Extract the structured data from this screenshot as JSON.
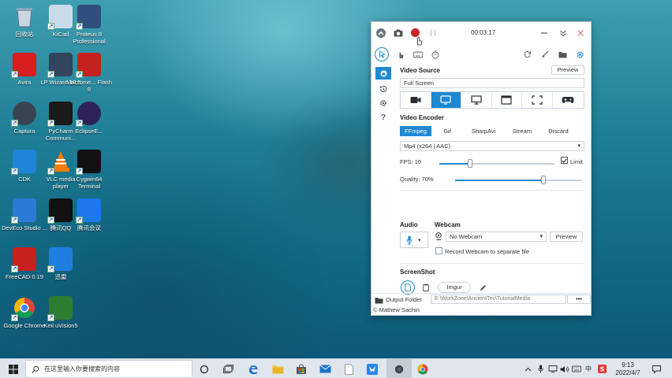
{
  "desktop": {
    "icons": [
      {
        "label": "回收站",
        "icon": "recycle-bin-icon",
        "color": "#6b8aa8"
      },
      {
        "label": "KiCad",
        "icon": "kicad-icon",
        "color": "#c9dbe9"
      },
      {
        "label": "Proteus 8 Professional",
        "icon": "proteus-icon",
        "color": "#2f4f7f"
      },
      {
        "label": "Avira",
        "icon": "avira-icon",
        "color": "#d81e1e"
      },
      {
        "label": "LP Wizard 10.5",
        "icon": "lp-wizard-icon",
        "color": "#33445d"
      },
      {
        "label": "Macrome... Flash 8",
        "icon": "flash-icon",
        "color": "#c5221f"
      },
      {
        "label": "Captura",
        "icon": "captura-icon",
        "color": "#3a4450"
      },
      {
        "label": "PyCharm Communi...",
        "icon": "pycharm-icon",
        "color": "#1a1a1a"
      },
      {
        "label": "EclipseE...",
        "icon": "eclipse-icon",
        "color": "#2c2255"
      },
      {
        "label": "CDK",
        "icon": "cdk-icon",
        "color": "#1f84d8"
      },
      {
        "label": "VLC media player",
        "icon": "vlc-icon",
        "color": "#f07c00"
      },
      {
        "label": "Cygwin64 Terminal",
        "icon": "cygwin-icon",
        "color": "#111111"
      },
      {
        "label": "DevEco Studio ...",
        "icon": "deveco-icon",
        "color": "#2a7bd6"
      },
      {
        "label": "腾讯QQ",
        "icon": "qq-icon",
        "color": "#111111"
      },
      {
        "label": "腾讯会议",
        "icon": "tencent-meeting-icon",
        "color": "#1e78f0"
      },
      {
        "label": "FreeCAD 0.19",
        "icon": "freecad-icon",
        "color": "#c92020"
      },
      {
        "label": "迅雷",
        "icon": "xunlei-icon",
        "color": "#1f7fe0"
      },
      {
        "label": "Google Chrome",
        "icon": "chrome-icon",
        "color": "#ffffff"
      },
      {
        "label": "Keil uVision5",
        "icon": "keil-icon",
        "color": "#2f7d32"
      }
    ]
  },
  "recorder": {
    "timer": "00:03:17",
    "video_source": {
      "title": "Video Source",
      "preview_label": "Preview",
      "value": "Full Screen",
      "sources": [
        "camera-icon",
        "screen-icon",
        "monitor-icon",
        "window-icon",
        "region-icon",
        "gamepad-icon"
      ],
      "active_index": 1
    },
    "video_encoder": {
      "title": "Video Encoder",
      "tabs": [
        "FFmpeg",
        "Gif",
        "SharpAvi",
        "Stream",
        "Discard"
      ],
      "active_tab": 0,
      "codec": "Mp4 (x264 | AAC)",
      "fps_label": "FPS:",
      "fps_value": "10",
      "fps_level": 0.27,
      "limit_label": "Limit",
      "limit_checked": true,
      "quality_label": "Quality:",
      "quality_value": "70%",
      "quality_level": 0.7
    },
    "audio": {
      "title": "Audio"
    },
    "webcam": {
      "title": "Webcam",
      "device": "No Webcam",
      "preview_label": "Preview",
      "separate_label": "Record Webcam to separate file",
      "separate_checked": false
    },
    "screenshot": {
      "title": "ScreenShot",
      "imgur_label": "Imgur"
    },
    "output": {
      "label": "Output Folder",
      "path": "E:\\WorkZone\\AncientTec\\TutorialMedia",
      "more_label": "•••"
    },
    "credit": "© Mathew Sachin",
    "accent": "#1e88d2",
    "record_color": "#c62828"
  },
  "taskbar": {
    "search_placeholder": "在这里输入你要搜索的内容",
    "ime_label": "中",
    "time": "9:13",
    "date": "2022/4/7"
  }
}
